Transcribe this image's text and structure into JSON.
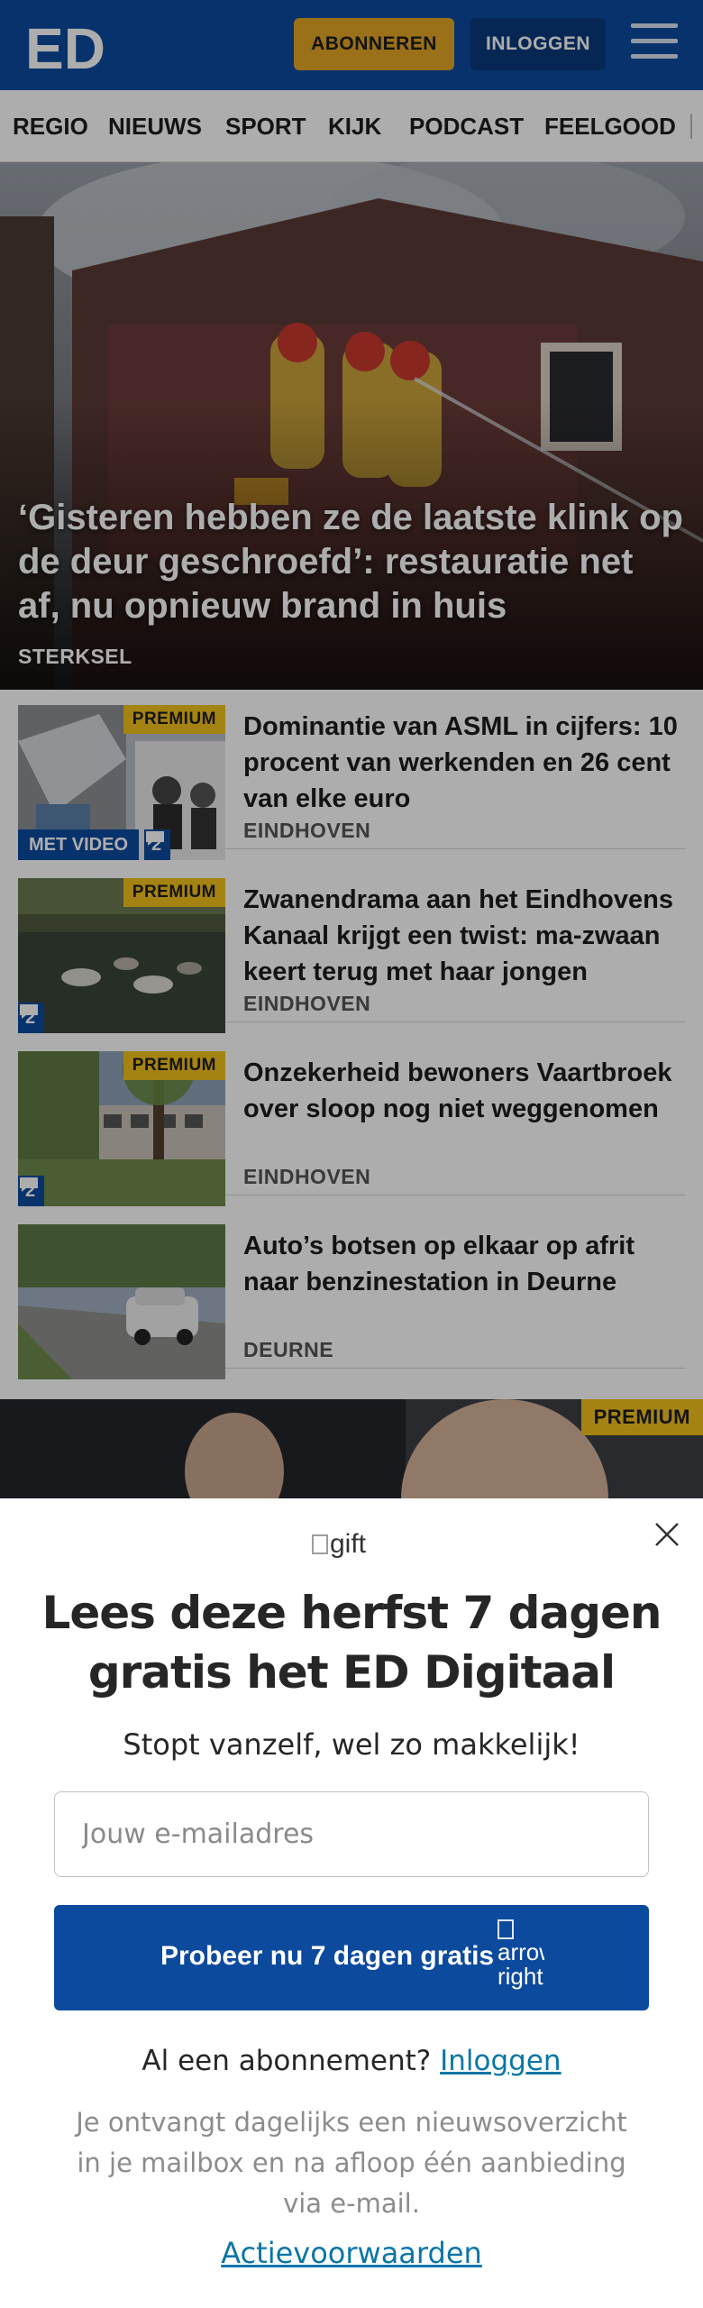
{
  "header": {
    "logo_text": "ED",
    "subscribe_label": "ABONNEREN",
    "login_label": "INLOGGEN"
  },
  "nav": {
    "items": [
      "REGIO",
      "NIEUWS",
      "SPORT",
      "KIJK",
      "PODCAST",
      "FEELGOOD"
    ]
  },
  "hero": {
    "title": "‘Gisteren hebben ze de laatste klink op de deur geschroefd’: restauratie net af, nu opnieuw brand in huis",
    "location": "STERKSEL"
  },
  "articles": [
    {
      "title": "Dominantie van ASML in cijfers: 10 procent van werkenden en 26 cent van elke euro",
      "location": "EINDHOVEN",
      "premium": "PREMIUM",
      "video": "MET VIDEO",
      "comments": "2"
    },
    {
      "title": "Zwanendrama aan het Eindhovens Kanaal krijgt een twist: ma-zwaan keert terug met haar jongen",
      "location": "EINDHOVEN",
      "premium": "PREMIUM",
      "comments": "2"
    },
    {
      "title": "Onzekerheid bewoners Vaartbroek over sloop nog niet weggenomen",
      "location": "EINDHOVEN",
      "premium": "PREMIUM",
      "comments": "2"
    },
    {
      "title": "Auto’s botsen op elkaar op afrit naar benzinestation in Deurne",
      "location": "DEURNE"
    }
  ],
  "promo_strip": {
    "premium": "PREMIUM"
  },
  "modal": {
    "gift_alt": "gift",
    "title": "Lees deze herfst 7 dagen gratis het ED Digitaal",
    "subtitle": "Stopt vanzelf, wel zo makkelijk!",
    "email_placeholder": "Jouw e-mailadres",
    "cta_label": "Probeer nu 7 dagen gratis",
    "cta_icon_alt": "arrow-right",
    "already_text": "Al een abonnement?",
    "login_link": "Inloggen",
    "info_text": "Je ontvangt dagelijks een nieuwsoverzicht in je mailbox en na afloop één aanbieding via e-mail.",
    "terms_link": "Actievoorwaarden"
  },
  "colors": {
    "brand_blue": "#0c4a9e",
    "subscribe_gold": "#e3a624",
    "premium_yellow": "#f2c21b",
    "link_blue": "#0a76a8"
  }
}
